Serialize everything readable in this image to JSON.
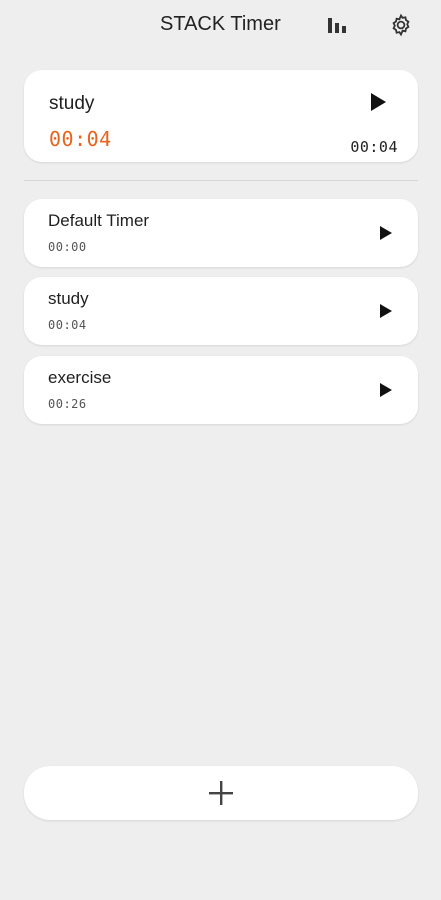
{
  "header": {
    "title": "STACK Timer",
    "stats_icon": "bar-chart-icon",
    "settings_icon": "gear-icon"
  },
  "active_timer": {
    "name": "study",
    "elapsed": "00:04",
    "total": "00:04",
    "elapsed_color": "#e8641e"
  },
  "timers": [
    {
      "name": "Default Timer",
      "time": "00:00"
    },
    {
      "name": "study",
      "time": "00:04"
    },
    {
      "name": "exercise",
      "time": "00:26"
    }
  ],
  "add_button": {
    "icon": "plus-icon"
  }
}
